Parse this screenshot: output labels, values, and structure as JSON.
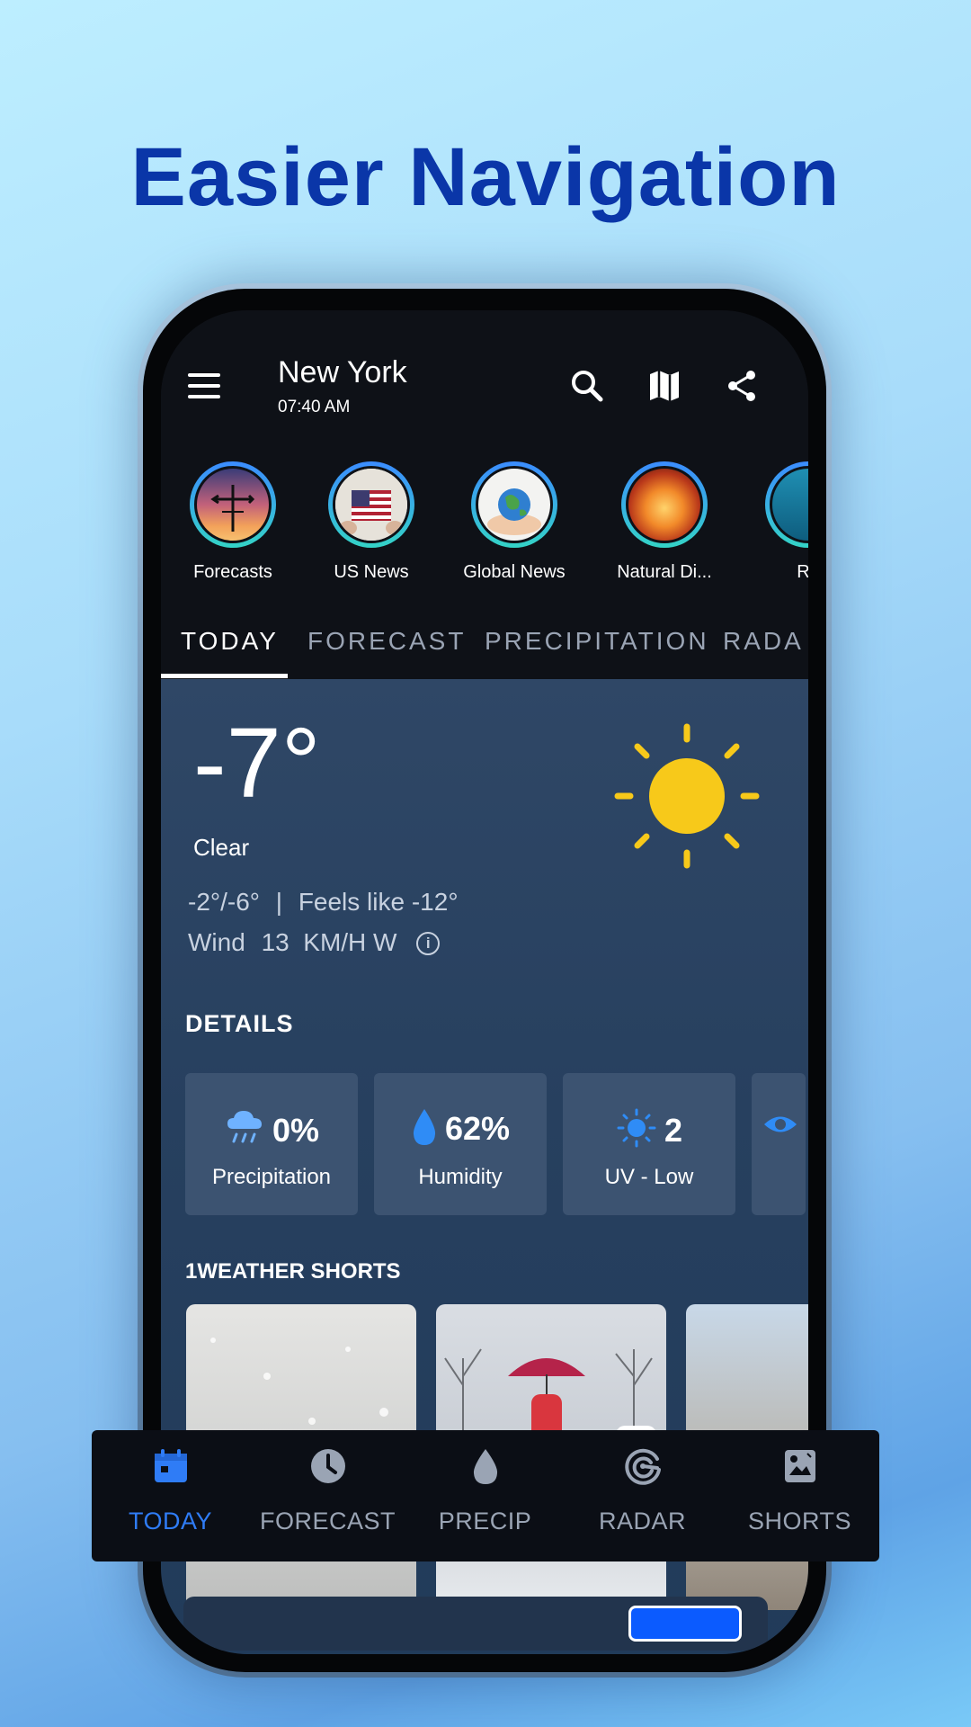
{
  "headline": "Easier Navigation",
  "header": {
    "city": "New York",
    "time": "07:40 AM"
  },
  "stories": [
    {
      "label": "Forecasts"
    },
    {
      "label": "US News"
    },
    {
      "label": "Global News"
    },
    {
      "label": "Natural Di..."
    },
    {
      "label": "Re"
    }
  ],
  "tabs": [
    {
      "label": "TODAY",
      "active": true
    },
    {
      "label": "FORECAST"
    },
    {
      "label": "PRECIPITATION"
    },
    {
      "label": "RADA"
    }
  ],
  "current": {
    "temperature": "-7°",
    "condition": "Clear",
    "range": "-2°/-6°",
    "feels_like": "Feels like -12°",
    "separator": "|",
    "wind_label": "Wind",
    "wind_value": "13  KM/H W",
    "info_glyph": "i"
  },
  "details": {
    "title": "DETAILS",
    "cards": [
      {
        "value": "0%",
        "caption": "Precipitation",
        "icon": "rain-cloud-icon"
      },
      {
        "value": "62%",
        "caption": "Humidity",
        "icon": "water-drop-icon"
      },
      {
        "value": "2",
        "caption": "UV - Low",
        "icon": "sun-icon"
      }
    ]
  },
  "shorts": {
    "title": "1WEATHER SHORTS"
  },
  "bottom_nav": [
    {
      "label": "TODAY",
      "icon": "calendar-icon",
      "active": true
    },
    {
      "label": "FORECAST",
      "icon": "clock-icon"
    },
    {
      "label": "PRECIP",
      "icon": "drop-icon"
    },
    {
      "label": "RADAR",
      "icon": "radar-icon"
    },
    {
      "label": "SHORTS",
      "icon": "shorts-icon"
    }
  ],
  "colors": {
    "headline": "#0a36a8",
    "accent": "#2f7cf6",
    "sun": "#f7c91a",
    "background_dark": "#0e1117"
  }
}
